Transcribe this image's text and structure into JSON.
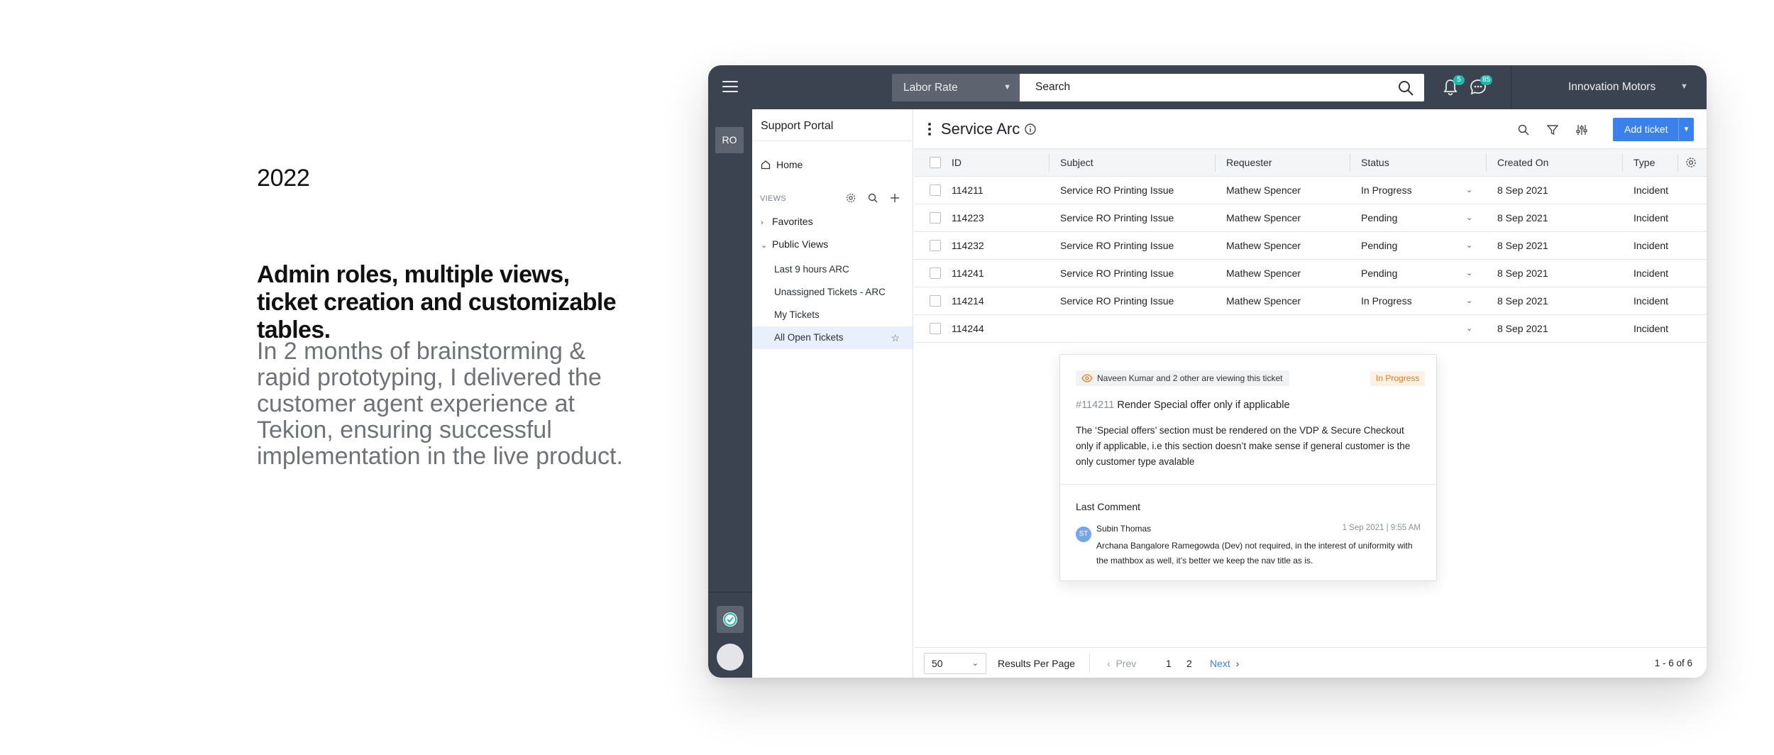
{
  "intro": {
    "year": "2022",
    "headline": "Admin roles, multiple views, ticket creation and customizable tables.",
    "body": "In 2 months of brainstorming & rapid prototyping, I delivered the customer agent experience at Tekion, ensuring successful implementation in the live product."
  },
  "topbar": {
    "filter_select": "Labor Rate",
    "search_value": "Search",
    "notification_count": "5",
    "message_count": "85",
    "organization": "Innovation Motors"
  },
  "rail": {
    "ro_label": "RO"
  },
  "nav": {
    "title": "Support Portal",
    "home": "Home",
    "views_label": "VIEWS",
    "favorites": "Favorites",
    "public_views": "Public Views",
    "items": [
      {
        "label": "Last 9 hours ARC"
      },
      {
        "label": "Unassigned Tickets - ARC"
      },
      {
        "label": "My Tickets"
      },
      {
        "label": "All Open Tickets"
      }
    ]
  },
  "main": {
    "title": "Service Arc",
    "add_ticket": "Add ticket",
    "columns": [
      "ID",
      "Subject",
      "Requester",
      "Status",
      "Created On",
      "Type"
    ],
    "rows": [
      {
        "id": "114211",
        "subject": "Service RO Printing Issue",
        "requester": "Mathew Spencer",
        "status": "In Progress",
        "created": "8 Sep 2021",
        "type": "Incident"
      },
      {
        "id": "114223",
        "subject": "Service RO Printing Issue",
        "requester": "Mathew Spencer",
        "status": "Pending",
        "created": "8 Sep 2021",
        "type": "Incident"
      },
      {
        "id": "114232",
        "subject": "Service RO Printing Issue",
        "requester": "Mathew Spencer",
        "status": "Pending",
        "created": "8 Sep 2021",
        "type": "Incident"
      },
      {
        "id": "114241",
        "subject": "Service RO Printing Issue",
        "requester": "Mathew Spencer",
        "status": "Pending",
        "created": "8 Sep 2021",
        "type": "Incident"
      },
      {
        "id": "114214",
        "subject": "Service RO Printing Issue",
        "requester": "Mathew Spencer",
        "status": "In Progress",
        "created": "8 Sep 2021",
        "type": "Incident"
      },
      {
        "id": "114244",
        "subject": "",
        "requester": "",
        "status": "",
        "created": "8 Sep 2021",
        "type": "Incident"
      }
    ]
  },
  "popover": {
    "viewers": "Naveen Kumar and 2 other are viewing this ticket",
    "status": "In Progress",
    "ticket_id": "#114211",
    "ticket_title": "Render Special offer only if applicable",
    "description": "The ‘Special offers’ section must be rendered on the VDP & Secure Checkout only if applicable, i.e this section doesn’t make sense if general customer is the only customer type avalable",
    "last_comment_label": "Last Comment",
    "author_initials": "ST",
    "author": "Subin Thomas",
    "date": "1 Sep 2021  |  9:55 AM",
    "comment": "Archana Bangalore Ramegowda (Dev)  not required, in the interest of uniformity with the mathbox as well, it’s better we keep the nav title as is."
  },
  "footer": {
    "per_page": "50",
    "per_page_label": "Results Per Page",
    "prev": "Prev",
    "pages": [
      "1",
      "2"
    ],
    "next": "Next",
    "count": "1 - 6 of 6"
  },
  "colors": {
    "topbar": "#3c4350",
    "accent": "#3a81ec",
    "badge": "#1fb8a8",
    "status_in_progress": "#e07a1f"
  },
  "icons": [
    "hamburger-icon",
    "chevron-down-icon",
    "search-icon",
    "bell-icon",
    "chat-icon",
    "shield-check-icon",
    "home-icon",
    "gear-icon",
    "plus-icon",
    "star-icon",
    "info-icon",
    "filter-icon",
    "sliders-icon",
    "eye-icon"
  ]
}
